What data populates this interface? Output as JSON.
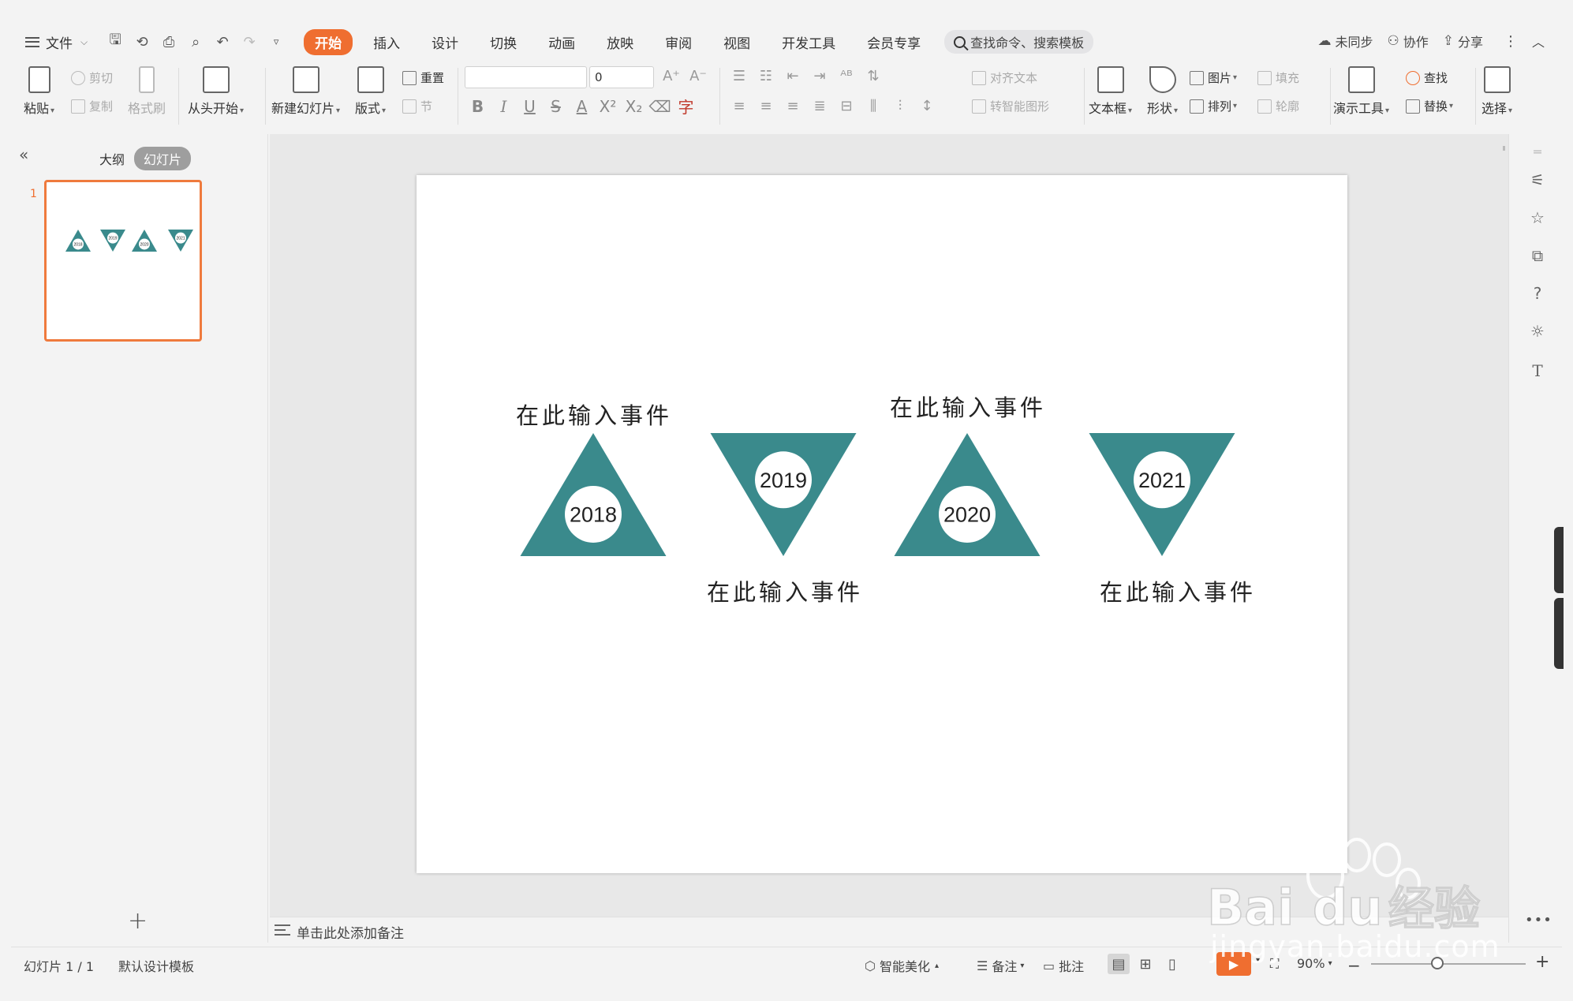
{
  "menubar": {
    "file_label": "文件",
    "tabs": [
      "开始",
      "插入",
      "设计",
      "切换",
      "动画",
      "放映",
      "审阅",
      "视图",
      "开发工具",
      "会员专享"
    ],
    "active_tab": "开始",
    "search_placeholder": "查找命令、搜索模板",
    "right": {
      "sync": "未同步",
      "collab": "协作",
      "share": "分享"
    }
  },
  "ribbon": {
    "paste": "粘贴",
    "cut": "剪切",
    "copy": "复制",
    "format_painter": "格式刷",
    "from_start": "从头开始",
    "new_slide": "新建幻灯片",
    "layout": "版式",
    "reset": "重置",
    "section": "节",
    "font_size": "0",
    "align_text": "对齐文本",
    "smartart": "转智能图形",
    "textbox": "文本框",
    "shape": "形状",
    "picture": "图片",
    "fill": "填充",
    "arrange": "排列",
    "outline": "轮廓",
    "present_tools": "演示工具",
    "find": "查找",
    "replace": "替换",
    "select": "选择"
  },
  "leftpanel": {
    "tab_outline": "大纲",
    "tab_slides": "幻灯片",
    "slide_number": "1"
  },
  "slide": {
    "accent_color": "#3a8a8c",
    "events": [
      {
        "year": "2018",
        "caption": "在此输入事件",
        "direction": "up"
      },
      {
        "year": "2019",
        "caption": "在此输入事件",
        "direction": "down"
      },
      {
        "year": "2020",
        "caption": "在此输入事件",
        "direction": "up"
      },
      {
        "year": "2021",
        "caption": "在此输入事件",
        "direction": "down"
      }
    ]
  },
  "notes": {
    "placeholder": "单击此处添加备注"
  },
  "status": {
    "slide_info": "幻灯片 1 / 1",
    "template": "默认设计模板",
    "beautify": "智能美化",
    "notes": "备注",
    "comment": "批注",
    "zoom": "90%"
  },
  "watermark": {
    "text": "jingyan.baidu.com"
  }
}
